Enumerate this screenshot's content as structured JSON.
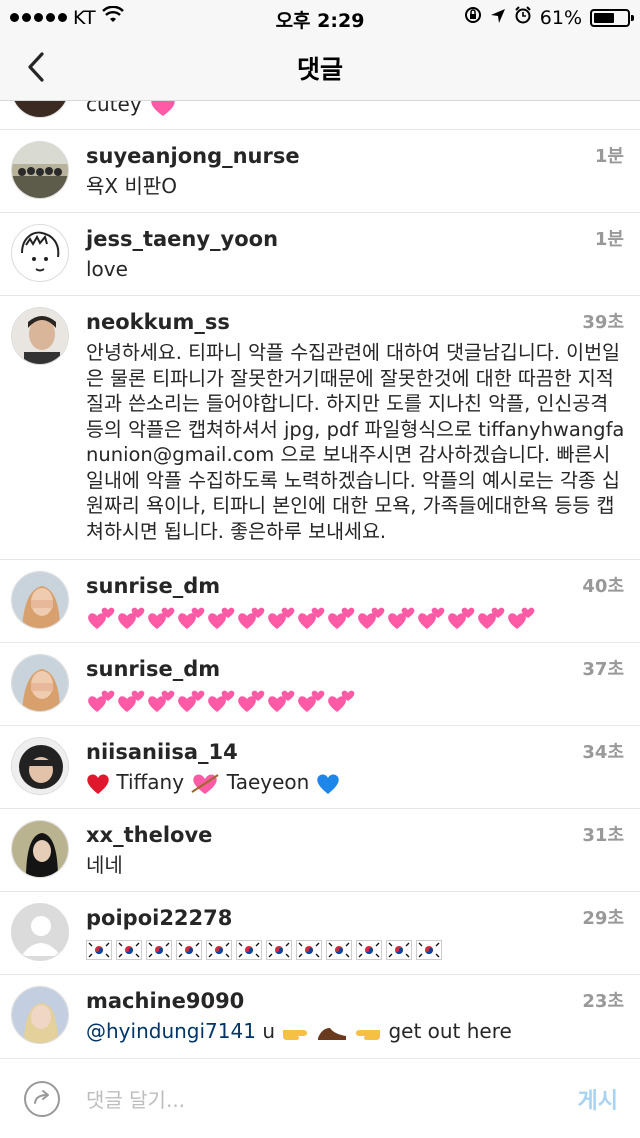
{
  "status": {
    "carrier": "KT",
    "time": "오후 2:29",
    "battery": "61%",
    "battery_level": 0.61
  },
  "header": {
    "title": "댓글",
    "back_icon": "chevron-left-icon"
  },
  "comments": [
    {
      "username": "",
      "time": "",
      "text": "cutey",
      "emoji": "sparkling-heart"
    },
    {
      "username": "suyeanjong_nurse",
      "time": "1분",
      "text": "욕X 비판O"
    },
    {
      "username": "jess_taeny_yoon",
      "time": "1분",
      "text": "love"
    },
    {
      "username": "neokkum_ss",
      "time": "39초",
      "text": "안녕하세요. 티파니 악플 수집관련에 대하여 댓글남깁니다. 이번일은 물론 티파니가 잘못한거기때문에 잘못한것에 대한 따끔한 지적질과 쓴소리는 들어야합니다. 하지만 도를 지나친 악플, 인신공격등의 악플은 캡쳐하셔서 jpg, pdf 파일형식으로 tiffanyhwangfanunion@gmail.com 으로 보내주시면 감사하겠습니다. 빠른시일내에 악플 수집하도록 노력하겠습니다.  악플의 예시로는 각종 십원짜리 욕이나, 티파니 본인에 대한 모욕, 가족들에대한욕 등등 캡쳐하시면 됩니다. 좋은하루 보내세요."
    },
    {
      "username": "sunrise_dm",
      "time": "40초",
      "heart_count": 15
    },
    {
      "username": "sunrise_dm",
      "time": "37초",
      "heart_count": 9
    },
    {
      "username": "niisaniisa_14",
      "time": "34초",
      "text_a": "Tiffany",
      "text_b": "Taeyeon"
    },
    {
      "username": "xx_thelove",
      "time": "31초",
      "text": "네네"
    },
    {
      "username": "poipoi22278",
      "time": "29초",
      "flag_count": 12
    },
    {
      "username": "machine9090",
      "time": "23초",
      "mention": "@hyindungi7141",
      "text_a": "u",
      "text_b": "get out here"
    }
  ],
  "composer": {
    "placeholder": "댓글 달기...",
    "post_label": "게시",
    "reply_icon": "reply-arrow-icon"
  },
  "colors": {
    "heart": "#ff5aa5",
    "mention": "#003569",
    "post_button": "#a8d3f2",
    "time": "#999999"
  }
}
